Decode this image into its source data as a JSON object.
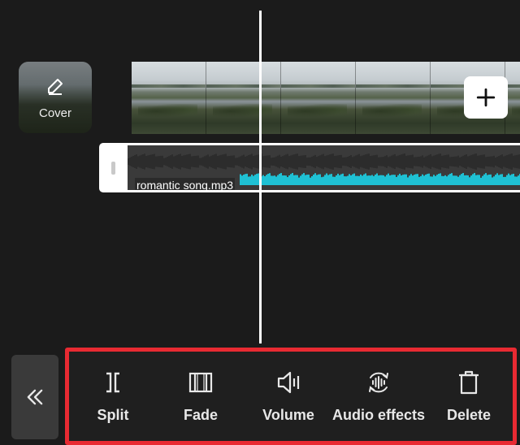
{
  "cover": {
    "label": "Cover",
    "icon": "pencil-icon"
  },
  "timeline": {
    "video_frames": 6,
    "add_clip_icon": "plus-icon",
    "audio": {
      "name": "romantic song.mp3",
      "waveform_color": "#1fc1d4"
    }
  },
  "bottom_bar": {
    "collapse_icon": "double-chevron-left-icon",
    "highlight_color": "#e82a32",
    "tools": [
      {
        "label": "Split",
        "icon": "split-icon"
      },
      {
        "label": "Fade",
        "icon": "fade-icon"
      },
      {
        "label": "Volume",
        "icon": "volume-icon"
      },
      {
        "label": "Audio effects",
        "icon": "audio-effects-icon"
      },
      {
        "label": "Delete",
        "icon": "trash-icon"
      }
    ]
  }
}
